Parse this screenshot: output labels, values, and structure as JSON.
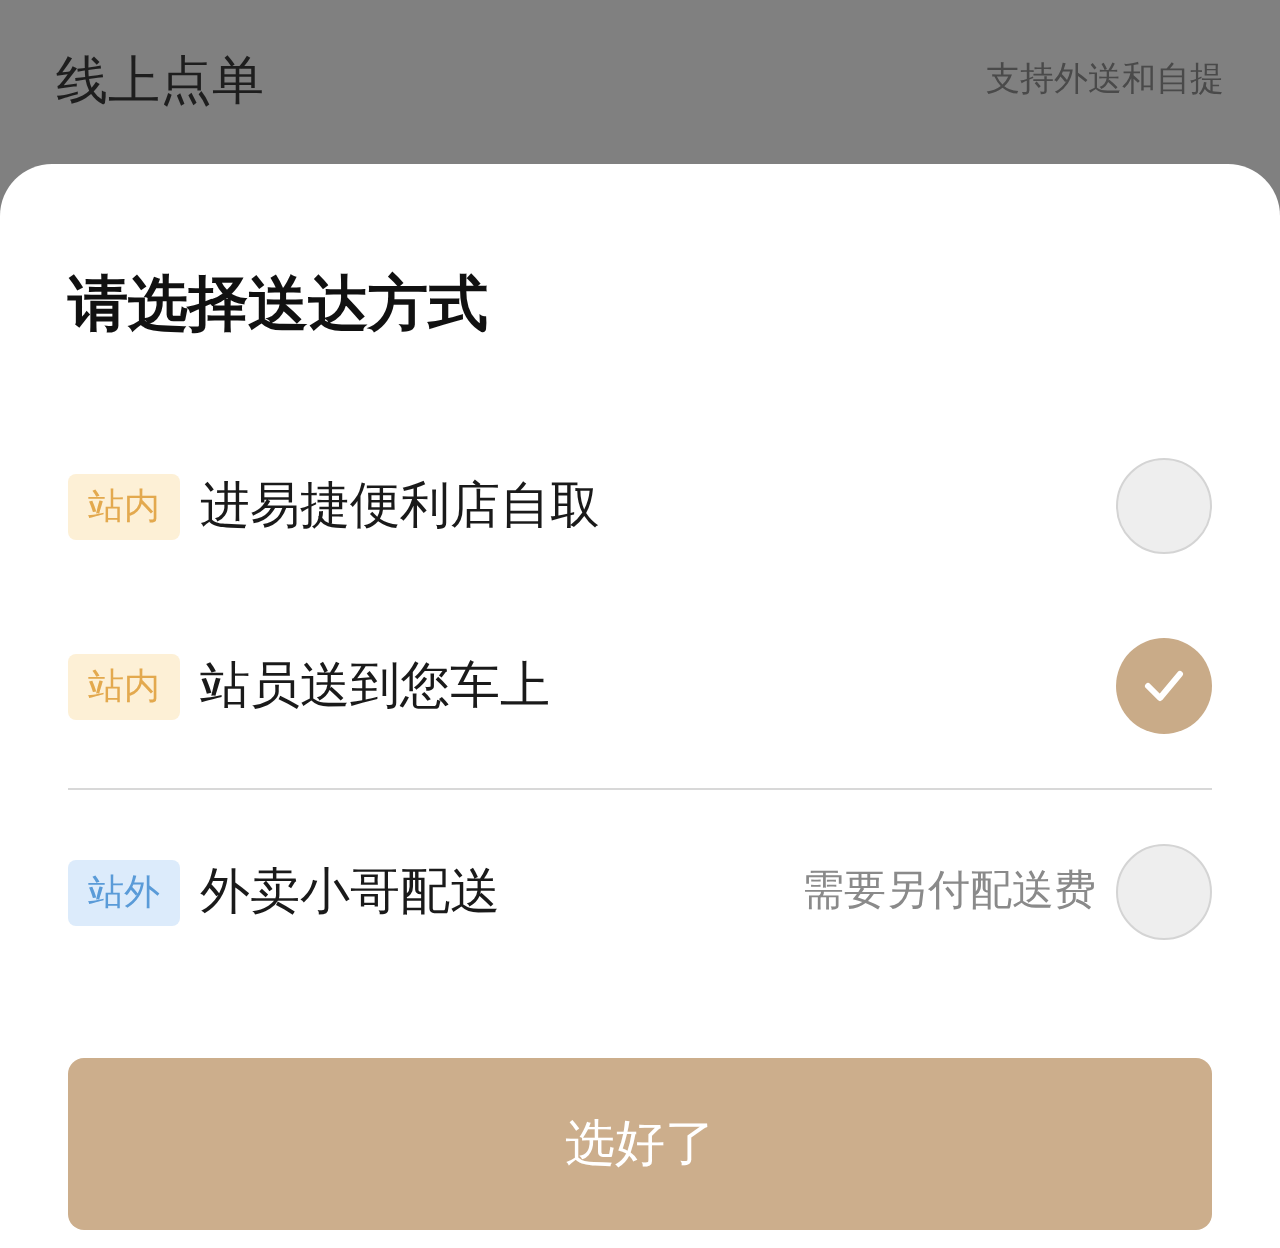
{
  "header": {
    "title": "线上点单",
    "subtitle": "支持外送和自提"
  },
  "sheet": {
    "title": "请选择送达方式",
    "options": [
      {
        "tag": "站内",
        "kind": "inside",
        "label": "进易捷便利店自取",
        "selected": false
      },
      {
        "tag": "站内",
        "kind": "inside",
        "label": "站员送到您车上",
        "selected": true
      },
      {
        "tag": "站外",
        "kind": "outside",
        "label": "外卖小哥配送",
        "note": "需要另付配送费",
        "selected": false
      }
    ],
    "confirm_button": "选好了"
  }
}
